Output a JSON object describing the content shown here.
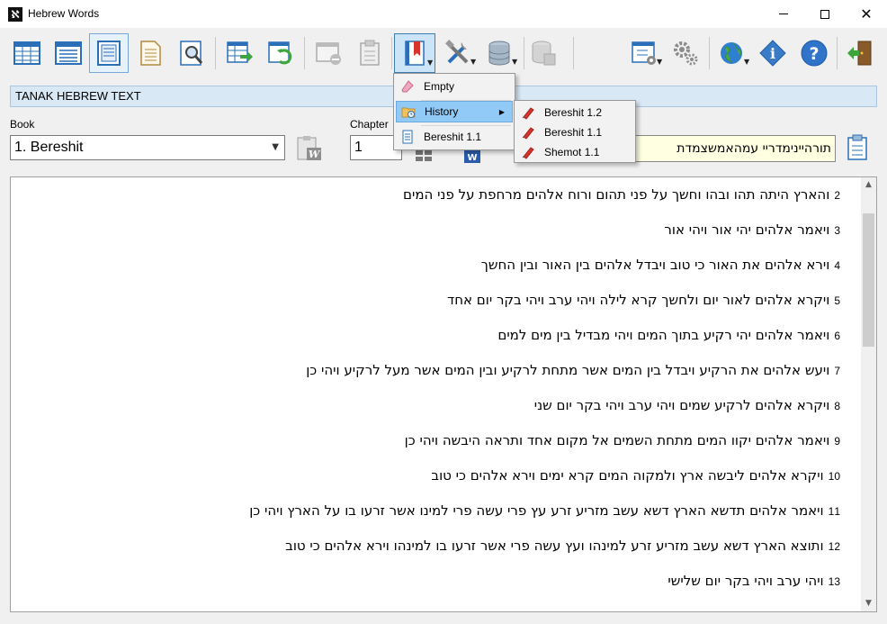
{
  "window": {
    "title": "Hebrew Words",
    "app_icon_glyph": "ℵ",
    "close_glyph": "✕"
  },
  "toolbar": {
    "icons": [
      "table-view-icon",
      "list-view-icon",
      "page-view-icon",
      "document-icon",
      "search-document-icon",
      "export-table-icon",
      "refresh-table-icon",
      "window-minus-icon",
      "clipboard-icon",
      "bookmarks-icon",
      "tools-icon",
      "database-icon",
      "save-database-icon",
      "settings-list-icon",
      "gears-icon",
      "globe-icon",
      "info-icon",
      "help-icon",
      "exit-door-icon"
    ],
    "help_glyph": "?",
    "info_glyph": "i"
  },
  "header": {
    "title": "TANAK HEBREW TEXT"
  },
  "book": {
    "label": "Book",
    "value": "1. Bereshit"
  },
  "chapter": {
    "label": "Chapter",
    "value": "1"
  },
  "find_text": "תורהיינימדריי עמהאמשצמדת",
  "verses": [
    {
      "num": "2",
      "text": "והארץ היתה תהו ובהו וחשך על פני תהום ורוח אלהים מרחפת על פני המים"
    },
    {
      "num": "3",
      "text": "ויאמר אלהים יהי אור ויהי אור"
    },
    {
      "num": "4",
      "text": "וירא אלהים את האור כי טוב ויבדל אלהים בין האור ובין החשך"
    },
    {
      "num": "5",
      "text": "ויקרא אלהים לאור יום ולחשך קרא לילה ויהי ערב ויהי בקר יום אחד"
    },
    {
      "num": "6",
      "text": "ויאמר אלהים יהי רקיע בתוך המים ויהי מבדיל בין מים למים"
    },
    {
      "num": "7",
      "text": "ויעש אלהים את הרקיע ויבדל בין המים אשר מתחת לרקיע ובין המים אשר מעל לרקיע ויהי כן"
    },
    {
      "num": "8",
      "text": "ויקרא אלהים לרקיע שמים ויהי ערב ויהי בקר יום שני"
    },
    {
      "num": "9",
      "text": "ויאמר אלהים יקוו המים מתחת השמים אל מקום אחד ותראה היבשה ויהי כן"
    },
    {
      "num": "10",
      "text": "ויקרא אלהים ליבשה ארץ ולמקוה המים קרא ימים וירא אלהים כי טוב"
    },
    {
      "num": "11",
      "text": "ויאמר אלהים תדשא הארץ דשא עשב מזריע זרע עץ פרי עשה פרי למינו אשר זרעו בו על הארץ ויהי כן"
    },
    {
      "num": "12",
      "text": "ותוצא הארץ דשא עשב מזריע זרע למינהו ועץ עשה פרי אשר זרעו בו למינהו וירא אלהים כי טוב"
    },
    {
      "num": "13",
      "text": "ויהי ערב ויהי בקר יום שלישי"
    }
  ],
  "menu": {
    "items": [
      {
        "label": "Empty",
        "icon": "eraser-icon"
      },
      {
        "label": "History",
        "icon": "history-folder-icon"
      },
      {
        "label": "Bereshit 1.1",
        "icon": "document-icon"
      }
    ],
    "submenu_arrow": "▶"
  },
  "submenu": {
    "items": [
      {
        "label": "Bereshit 1.2",
        "icon": "bookmark-pin-icon"
      },
      {
        "label": "Bereshit 1.1",
        "icon": "bookmark-pin-icon"
      },
      {
        "label": "Shemot 1.1",
        "icon": "bookmark-pin-icon"
      }
    ]
  },
  "colors": {
    "accent": "#3c7fb1",
    "header_bg": "#d8e8f5",
    "find_bg": "#ffffe1",
    "menu_highlight": "#91c9f7"
  }
}
